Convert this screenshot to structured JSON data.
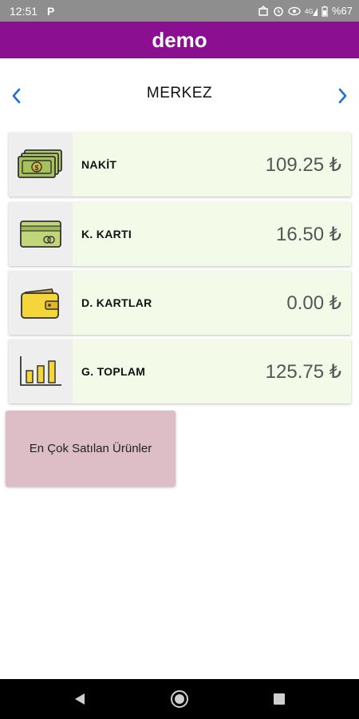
{
  "status_bar": {
    "time": "12:51",
    "p_icon": "P",
    "battery": "%67"
  },
  "app_bar": {
    "title": "demo"
  },
  "branch_nav": {
    "name": "MERKEZ"
  },
  "cards": [
    {
      "label": "NAKİT",
      "amount": "109.25 ₺",
      "icon": "cash-icon"
    },
    {
      "label": "K. KARTI",
      "amount": "16.50 ₺",
      "icon": "credit-card-icon"
    },
    {
      "label": "D. KARTLAR",
      "amount": "0.00 ₺",
      "icon": "wallet-icon"
    },
    {
      "label": "G. TOPLAM",
      "amount": "125.75 ₺",
      "icon": "bar-chart-icon"
    }
  ],
  "top_products_button": {
    "label": "En Çok Satılan Ürünler"
  },
  "colors": {
    "app_bar": "#8a0f91",
    "card_bg": "#f3fbe8",
    "button_bg": "#ddbec7",
    "arrow": "#1e6fd9"
  }
}
